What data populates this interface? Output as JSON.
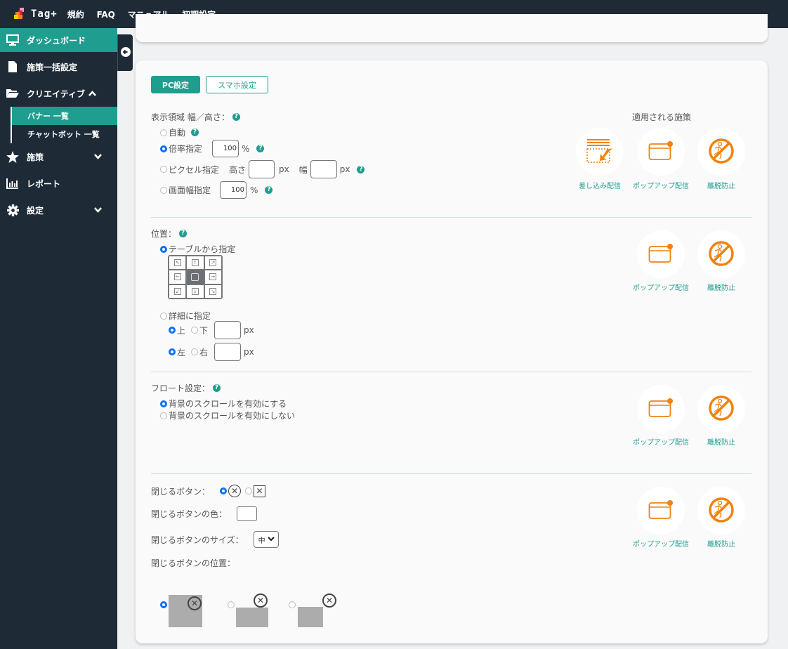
{
  "topbar": {
    "logo_text": "Tag+",
    "nav": [
      "規約",
      "FAQ",
      "マニュアル",
      "初期設定"
    ]
  },
  "sidebar": {
    "items": [
      {
        "label": "ダッシュボード",
        "icon": "monitor-icon",
        "active": true
      },
      {
        "label": "施策一括設定",
        "icon": "file-icon"
      },
      {
        "label": "クリエイティブ",
        "icon": "folder-open-icon",
        "expanded": true,
        "sub": [
          {
            "label": "バナー 一覧",
            "active": true
          },
          {
            "label": "チャットボット 一覧"
          }
        ]
      },
      {
        "label": "施策",
        "icon": "star-icon"
      },
      {
        "label": "レポート",
        "icon": "bar-chart-icon"
      },
      {
        "label": "設定",
        "icon": "gear-icon"
      }
    ]
  },
  "tabs": {
    "pc": "PC設定",
    "sp": "スマホ設定"
  },
  "display_area": {
    "label": "表示領域 幅／高さ：",
    "options": {
      "auto": "自動",
      "ratio": "倍率指定",
      "pixel": "ピクセル指定",
      "screen": "画面幅指定"
    },
    "ratio_value": "100",
    "percent": "%",
    "height_label": "高さ",
    "width_label": "幅",
    "px": "px",
    "screen_value": "100",
    "selected": "ratio"
  },
  "applied": {
    "title": "適用される施策",
    "insert": "差し込み配信",
    "popup": "ポップアップ配信",
    "exit": "離脱防止"
  },
  "position": {
    "label": "位置：",
    "table_option": "テーブルから指定",
    "detail_option": "詳細に指定",
    "top": "上",
    "bottom": "下",
    "left": "左",
    "right": "右",
    "px": "px",
    "grid": [
      "↖",
      "↑",
      "↗",
      "←",
      "▢",
      "→",
      "↙",
      "↓",
      "↘"
    ],
    "selected": "table"
  },
  "float": {
    "label": "フロート設定：",
    "enable": "背景のスクロールを有効にする",
    "disable": "背景のスクロールを有効にしない",
    "selected": "enable"
  },
  "close": {
    "button_label": "閉じるボタン：",
    "color_label": "閉じるボタンの色：",
    "size_label": "閉じるボタンのサイズ：",
    "size_value": "中",
    "position_label": "閉じるボタンの位置："
  },
  "colors": {
    "accent": "#1f9e8f",
    "nav_bg": "#1e2a36",
    "orange": "#f0820f",
    "radio_on": "#0d6efd"
  }
}
